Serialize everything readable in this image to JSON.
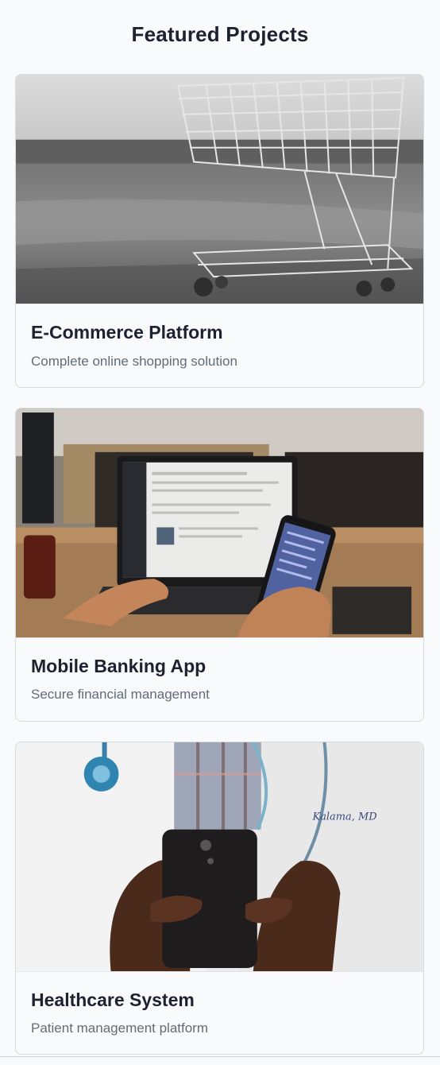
{
  "section": {
    "title": "Featured Projects"
  },
  "projects": [
    {
      "title": "E-Commerce Platform",
      "description": "Complete online shopping solution",
      "image_icon": "shopping-cart-photo"
    },
    {
      "title": "Mobile Banking App",
      "description": "Secure financial management",
      "image_icon": "laptop-and-phone-photo"
    },
    {
      "title": "Healthcare System",
      "description": "Patient management platform",
      "image_icon": "doctor-with-phone-photo"
    }
  ]
}
